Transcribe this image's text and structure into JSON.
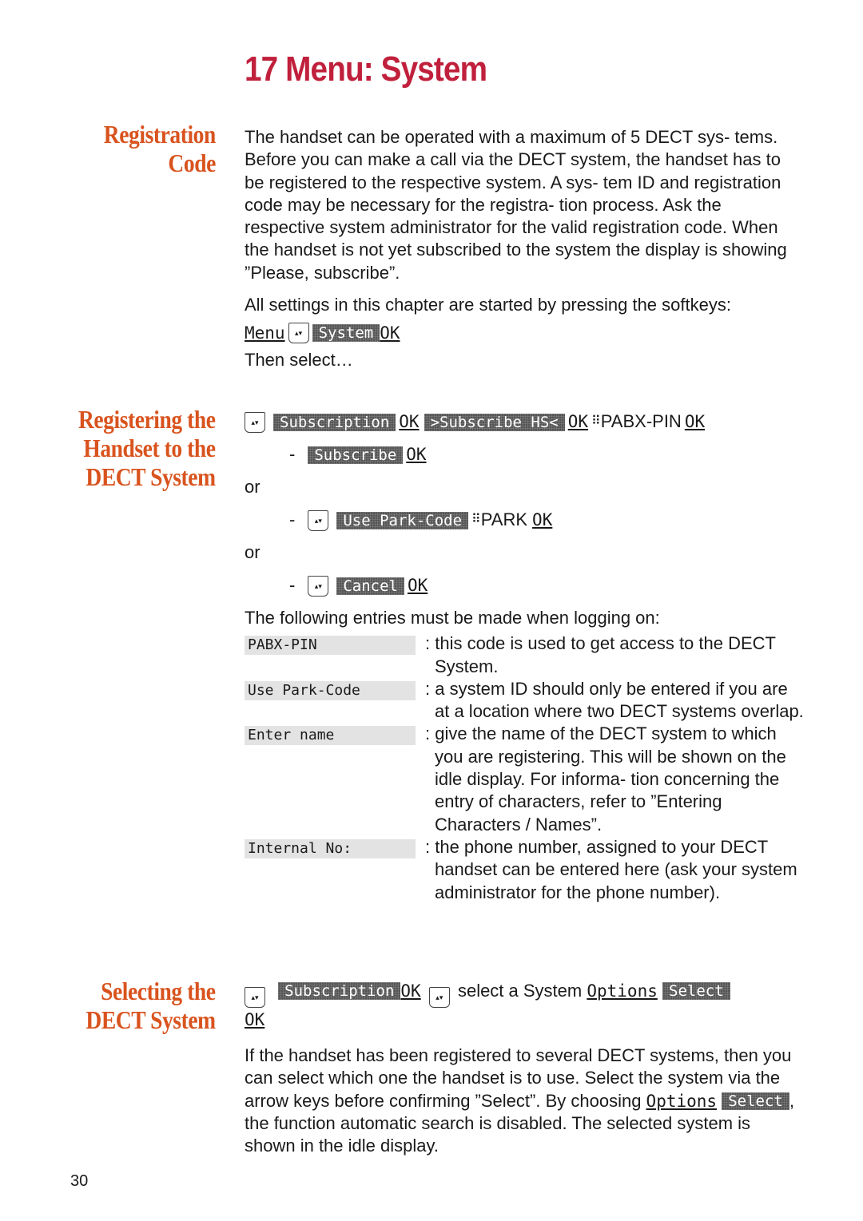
{
  "page": {
    "title": "17  Menu: System",
    "page_number": "30",
    "colors": {
      "title": "#c0203c",
      "section_heading": "#d9531e"
    }
  },
  "sections": {
    "registration_code": {
      "heading_line1": "Registration",
      "heading_line2": "Code",
      "paragraph": "The handset can be operated with a maximum of 5 DECT sys- tems. Before you can make a call via the DECT system, the handset has to be registered to the respective system. A sys- tem ID and registration code may be necessary for the registra- tion process. Ask the respective system administrator for the valid registration code. When the handset is not yet subscribed to the system the display is showing ”Please, subscribe”.",
      "softkeys_intro": "All settings in this chapter are started by pressing the softkeys:",
      "softkeys": {
        "menu": "Menu",
        "system": "System",
        "ok": "OK"
      },
      "then_select": "Then select…"
    },
    "registering": {
      "heading_line1": "Registering the",
      "heading_line2": "Handset to the",
      "heading_line3": "DECT System",
      "step1": {
        "subscription": "Subscription",
        "ok": "OK",
        "subscribe_hs": ">Subscribe HS<",
        "pabx_pin": "PABX-PIN"
      },
      "dash": "-",
      "step2": {
        "subscribe": "Subscribe",
        "ok": "OK"
      },
      "or": "or",
      "step3": {
        "use_park_code": "Use Park-Code",
        "park": "PARK",
        "ok": "OK"
      },
      "step4": {
        "cancel": "Cancel",
        "ok": "OK"
      },
      "entries_intro": "The following entries must be made when logging on:",
      "entries": [
        {
          "label": "PABX-PIN",
          "desc": ": this code is used to get access to the DECT System."
        },
        {
          "label": "Use Park-Code",
          "desc": ": a system ID should only be entered if you are at a location where two DECT systems overlap."
        },
        {
          "label": "Enter name",
          "desc": ": give the name of the DECT system to which you are registering. This will be shown on the idle display. For informa- tion concerning the entry of characters, refer to ”Entering Characters / Names”."
        },
        {
          "label": "Internal No:",
          "desc": ": the phone number, assigned to your DECT handset can be entered here (ask your system administrator for the phone number)."
        }
      ]
    },
    "selecting": {
      "heading_line1": "Selecting the",
      "heading_line2": "DECT System",
      "sequence": {
        "subscription": "Subscription",
        "ok": "OK",
        "text": "select a System",
        "options": "Options",
        "select": "Select",
        "ok2": "OK"
      },
      "para_part1": "If the handset has been registered to several DECT systems, then you can select which one the handset is to use. Select the system via the arrow keys before confirming ”Select”. By choosing ",
      "para_options": "Options",
      "para_select": "Select",
      "para_part2": ", the function automatic search is disabled. The selected system is shown in the idle display."
    }
  }
}
